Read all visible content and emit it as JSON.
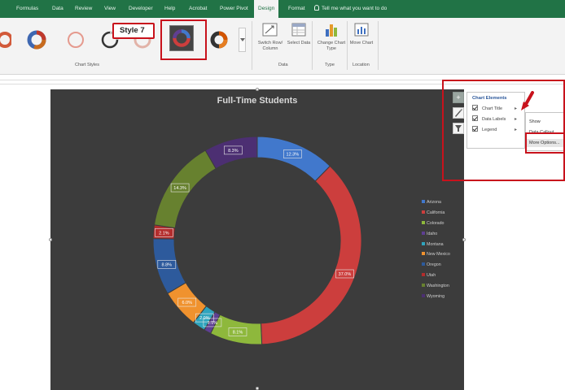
{
  "ribbon": {
    "tabs": [
      "Formulas",
      "Data",
      "Review",
      "View",
      "Developer",
      "Help",
      "Acrobat",
      "Power Pivot",
      "Design",
      "Format"
    ],
    "active_tab": "Design",
    "tell_me": "Tell me what you want to do",
    "groups": {
      "chart_styles": "Chart Styles",
      "data": "Data",
      "type": "Type",
      "location": "Location"
    },
    "buttons": {
      "switch_row_column": "Switch Row/ Column",
      "select_data": "Select Data",
      "change_chart_type": "Change Chart Type",
      "move_chart": "Move Chart"
    },
    "style_callout": "Style 7"
  },
  "chart_elements": {
    "title": "Chart Elements",
    "items": [
      "Chart Title",
      "Data Labels",
      "Legend"
    ],
    "submenu": [
      "Show",
      "Data Callout",
      "More Options..."
    ]
  },
  "chart_data": {
    "type": "pie",
    "title": "Full-Time Students",
    "categories": [
      "Arizona",
      "California",
      "Colorado",
      "Idaho",
      "Montana",
      "New Mexico",
      "Oregon",
      "Utah",
      "Washington",
      "Wyoming"
    ],
    "values": [
      12.3,
      37.0,
      8.1,
      1.1,
      2.0,
      6.0,
      8.8,
      2.1,
      14.3,
      8.3
    ],
    "colors": [
      "#4178cc",
      "#cc3e3d",
      "#8eb83c",
      "#5e3f93",
      "#2fa4bd",
      "#f0922e",
      "#2d5a9c",
      "#b32c2c",
      "#67812f",
      "#4c2f72"
    ],
    "data_labels": [
      "12.3%",
      "37.0%",
      "8.1%",
      "1.1%",
      "2.0%",
      "6.0%",
      "8.8%",
      "2.1%",
      "14.3%",
      "8.3%"
    ]
  }
}
